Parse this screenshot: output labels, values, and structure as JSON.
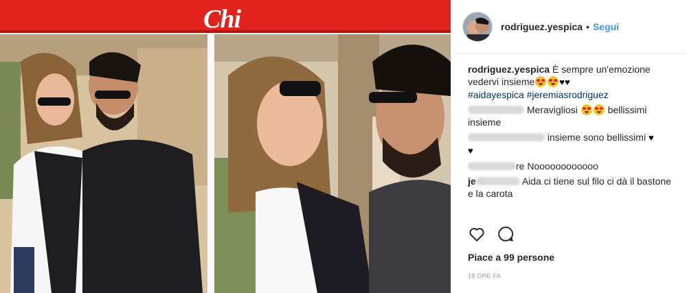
{
  "magazine": {
    "logo": "Chi",
    "brand_color": "#e0211c"
  },
  "post": {
    "username": "rodriguez.yespica",
    "separator": "•",
    "follow_label": "Segui",
    "caption": {
      "username": "rodriguez.yespica",
      "text": "È sempre un'emozione vedervi insieme",
      "hashtags": [
        "#aidayespica",
        "#jeremiasrodriguez"
      ]
    },
    "comments": [
      {
        "username": "",
        "text": "Meravigliosi",
        "text_after": "bellissimi insieme"
      },
      {
        "username": "",
        "text": "insieme sono bellissimi"
      },
      {
        "username": "",
        "text": "re Noooooooooooo"
      },
      {
        "username": "je",
        "text": "Aida ci tiene sul filo ci dà il bastone e la carota"
      }
    ],
    "actions": {
      "like_icon": "heart-outline-icon",
      "comment_icon": "comment-bubble-icon"
    },
    "likes_text": "Piace a 99 persone",
    "timestamp": "18 ORE FA",
    "accent_color": "#3897f0"
  }
}
